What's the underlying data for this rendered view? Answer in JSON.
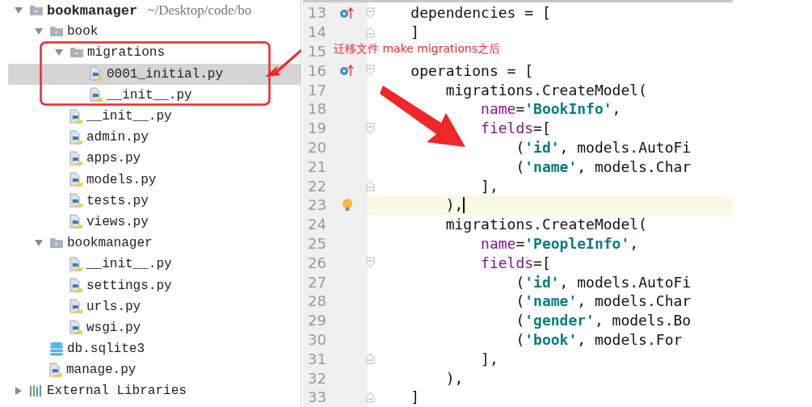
{
  "project_tree": {
    "items": [
      {
        "name": "bookmanager",
        "path": "~/Desktop/code/bo",
        "kind": "folder",
        "expanded": true,
        "selected": false,
        "children": [
          {
            "name": "book",
            "kind": "folder",
            "expanded": true,
            "selected": false,
            "children": [
              {
                "name": "migrations",
                "kind": "folder",
                "expanded": true,
                "selected": false,
                "children": [
                  {
                    "name": "0001_initial.py",
                    "kind": "python",
                    "selected": true
                  },
                  {
                    "name": "__init__.py",
                    "kind": "python",
                    "selected": false
                  }
                ]
              },
              {
                "name": "__init__.py",
                "kind": "python",
                "selected": false
              },
              {
                "name": "admin.py",
                "kind": "python",
                "selected": false
              },
              {
                "name": "apps.py",
                "kind": "python",
                "selected": false
              },
              {
                "name": "models.py",
                "kind": "python",
                "selected": false
              },
              {
                "name": "tests.py",
                "kind": "python",
                "selected": false
              },
              {
                "name": "views.py",
                "kind": "python",
                "selected": false
              }
            ]
          },
          {
            "name": "bookmanager",
            "kind": "folder",
            "expanded": true,
            "selected": false,
            "children": [
              {
                "name": "__init__.py",
                "kind": "python",
                "selected": false
              },
              {
                "name": "settings.py",
                "kind": "python",
                "selected": false
              },
              {
                "name": "urls.py",
                "kind": "python",
                "selected": false
              },
              {
                "name": "wsgi.py",
                "kind": "python",
                "selected": false
              }
            ]
          },
          {
            "name": "db.sqlite3",
            "kind": "database",
            "selected": false
          },
          {
            "name": "manage.py",
            "kind": "python",
            "selected": false
          }
        ]
      },
      {
        "name": "External Libraries",
        "kind": "library",
        "expanded": false,
        "selected": false
      }
    ]
  },
  "annotation": {
    "text": "迁移文件 make migrations之后"
  },
  "editor": {
    "lines": [
      {
        "number": "13",
        "override_marker": true,
        "fold_open": true,
        "fold_close": false,
        "bulb": false,
        "current": false,
        "tokens": [
          {
            "kind": "plain",
            "text": "    dependencies = ["
          }
        ]
      },
      {
        "number": "14",
        "override_marker": false,
        "fold_open": false,
        "fold_close": true,
        "bulb": false,
        "current": false,
        "tokens": [
          {
            "kind": "plain",
            "text": "    ]"
          }
        ]
      },
      {
        "number": "15",
        "override_marker": false,
        "fold_open": false,
        "fold_close": false,
        "bulb": false,
        "current": false
      },
      {
        "number": "16",
        "override_marker": true,
        "fold_open": true,
        "fold_close": false,
        "bulb": false,
        "current": false,
        "tokens": [
          {
            "kind": "plain",
            "text": "    operations = ["
          }
        ]
      },
      {
        "number": "17",
        "override_marker": false,
        "fold_open": false,
        "fold_close": false,
        "bulb": false,
        "current": false,
        "tokens": [
          {
            "kind": "plain",
            "text": "        migrations.CreateModel("
          }
        ]
      },
      {
        "number": "18",
        "override_marker": false,
        "fold_open": false,
        "fold_close": false,
        "bulb": false,
        "current": false,
        "tokens": [
          {
            "kind": "keyword",
            "text": "            name"
          },
          {
            "kind": "plain",
            "text": "="
          },
          {
            "kind": "string",
            "text": "'BookInfo'"
          },
          {
            "kind": "plain",
            "text": ","
          }
        ]
      },
      {
        "number": "19",
        "override_marker": false,
        "fold_open": true,
        "fold_close": false,
        "bulb": false,
        "current": false,
        "tokens": [
          {
            "kind": "keyword",
            "text": "            fields"
          },
          {
            "kind": "plain",
            "text": "=["
          }
        ]
      },
      {
        "number": "20",
        "override_marker": false,
        "fold_open": false,
        "fold_close": false,
        "bulb": false,
        "current": false,
        "tokens": [
          {
            "kind": "plain",
            "text": "                ("
          },
          {
            "kind": "string",
            "text": "'id'"
          },
          {
            "kind": "plain",
            "text": ", models.AutoFi"
          }
        ]
      },
      {
        "number": "21",
        "override_marker": false,
        "fold_open": false,
        "fold_close": false,
        "bulb": false,
        "current": false,
        "tokens": [
          {
            "kind": "plain",
            "text": "                ("
          },
          {
            "kind": "string",
            "text": "'name'"
          },
          {
            "kind": "plain",
            "text": ", models.Char"
          }
        ]
      },
      {
        "number": "22",
        "override_marker": false,
        "fold_open": false,
        "fold_close": true,
        "bulb": false,
        "current": false,
        "tokens": [
          {
            "kind": "plain",
            "text": "            ],"
          }
        ]
      },
      {
        "number": "23",
        "override_marker": false,
        "fold_open": false,
        "fold_close": false,
        "bulb": true,
        "current": true,
        "tokens": [
          {
            "kind": "plain",
            "text": "        ),"
          }
        ]
      },
      {
        "number": "24",
        "override_marker": false,
        "fold_open": false,
        "fold_close": false,
        "bulb": false,
        "current": false,
        "tokens": [
          {
            "kind": "plain",
            "text": "        migrations.CreateModel("
          }
        ]
      },
      {
        "number": "25",
        "override_marker": false,
        "fold_open": false,
        "fold_close": false,
        "bulb": false,
        "current": false,
        "tokens": [
          {
            "kind": "keyword",
            "text": "            name"
          },
          {
            "kind": "plain",
            "text": "="
          },
          {
            "kind": "string",
            "text": "'PeopleInfo'"
          },
          {
            "kind": "plain",
            "text": ","
          }
        ]
      },
      {
        "number": "26",
        "override_marker": false,
        "fold_open": true,
        "fold_close": false,
        "bulb": false,
        "current": false,
        "tokens": [
          {
            "kind": "keyword",
            "text": "            fields"
          },
          {
            "kind": "plain",
            "text": "=["
          }
        ]
      },
      {
        "number": "27",
        "override_marker": false,
        "fold_open": false,
        "fold_close": false,
        "bulb": false,
        "current": false,
        "tokens": [
          {
            "kind": "plain",
            "text": "                ("
          },
          {
            "kind": "string",
            "text": "'id'"
          },
          {
            "kind": "plain",
            "text": ", models.AutoFi"
          }
        ]
      },
      {
        "number": "28",
        "override_marker": false,
        "fold_open": false,
        "fold_close": false,
        "bulb": false,
        "current": false,
        "tokens": [
          {
            "kind": "plain",
            "text": "                ("
          },
          {
            "kind": "string",
            "text": "'name'"
          },
          {
            "kind": "plain",
            "text": ", models.Char"
          }
        ]
      },
      {
        "number": "29",
        "override_marker": false,
        "fold_open": false,
        "fold_close": false,
        "bulb": false,
        "current": false,
        "tokens": [
          {
            "kind": "plain",
            "text": "                ("
          },
          {
            "kind": "string",
            "text": "'gender'"
          },
          {
            "kind": "plain",
            "text": ", models.Bo"
          }
        ]
      },
      {
        "number": "30",
        "override_marker": false,
        "fold_open": false,
        "fold_close": false,
        "bulb": false,
        "current": false,
        "tokens": [
          {
            "kind": "plain",
            "text": "                ("
          },
          {
            "kind": "string",
            "text": "'book'"
          },
          {
            "kind": "plain",
            "text": ", models.For"
          }
        ]
      },
      {
        "number": "31",
        "override_marker": false,
        "fold_open": false,
        "fold_close": true,
        "bulb": false,
        "current": false,
        "tokens": [
          {
            "kind": "plain",
            "text": "            ],"
          }
        ]
      },
      {
        "number": "32",
        "override_marker": false,
        "fold_open": false,
        "fold_close": false,
        "bulb": false,
        "current": false,
        "tokens": [
          {
            "kind": "plain",
            "text": "        ),"
          }
        ]
      },
      {
        "number": "33",
        "override_marker": false,
        "fold_open": false,
        "fold_close": true,
        "bulb": false,
        "current": false,
        "tokens": [
          {
            "kind": "plain",
            "text": "    ]"
          }
        ]
      }
    ]
  }
}
